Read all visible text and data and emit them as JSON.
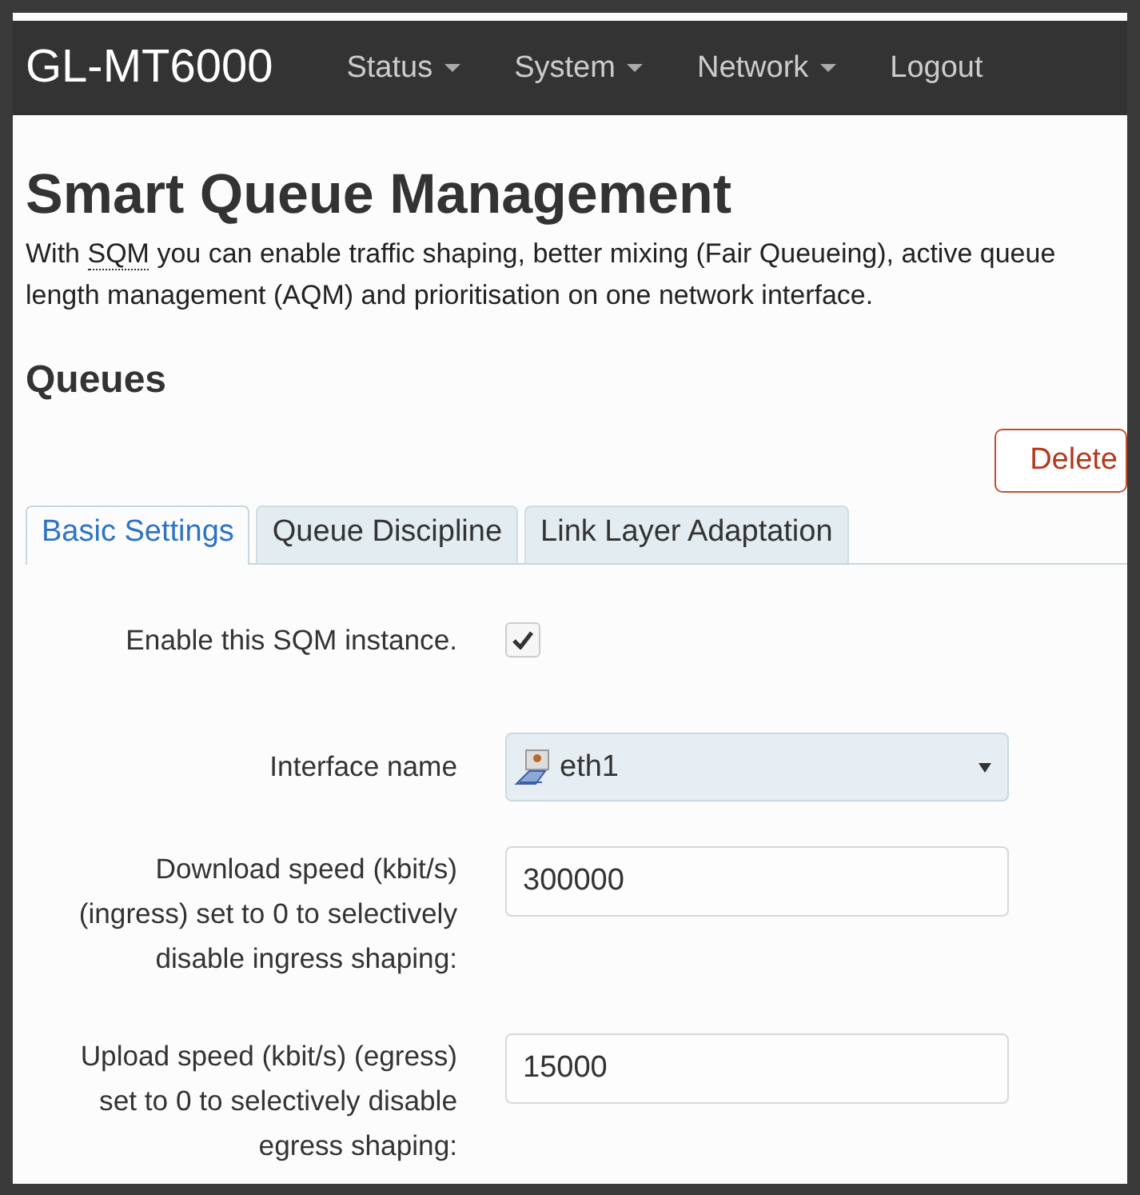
{
  "navbar": {
    "brand": "GL-MT6000",
    "menu": [
      {
        "label": "Status",
        "dropdown": true
      },
      {
        "label": "System",
        "dropdown": true
      },
      {
        "label": "Network",
        "dropdown": true
      },
      {
        "label": "Logout",
        "dropdown": false
      }
    ]
  },
  "page": {
    "title": "Smart Queue Management",
    "description_parts": [
      {
        "text": "With ",
        "abbr": false
      },
      {
        "text": "SQM",
        "abbr": true
      },
      {
        "text": " you can enable traffic shaping, better mixing (Fair Queueing), active queue length management (AQM) and prioritisation on one network interface.",
        "abbr": false
      }
    ]
  },
  "section": {
    "title": "Queues",
    "delete_button": "Delete"
  },
  "tabs": [
    {
      "label": "Basic Settings",
      "selected": true
    },
    {
      "label": "Queue Discipline",
      "selected": false
    },
    {
      "label": "Link Layer Adaptation",
      "selected": false
    }
  ],
  "fields": [
    {
      "kind": "checkbox",
      "label": "Enable this SQM instance.",
      "checked": true
    },
    {
      "kind": "select",
      "label": "Interface name",
      "value": "eth1"
    },
    {
      "kind": "text",
      "label": "Download speed (kbit/s) (ingress) set to 0 to selectively disable ingress shaping:",
      "value": "300000"
    },
    {
      "kind": "text",
      "label": "Upload speed (kbit/s) (egress) set to 0 to selectively disable egress shaping:",
      "value": "15000"
    }
  ]
}
